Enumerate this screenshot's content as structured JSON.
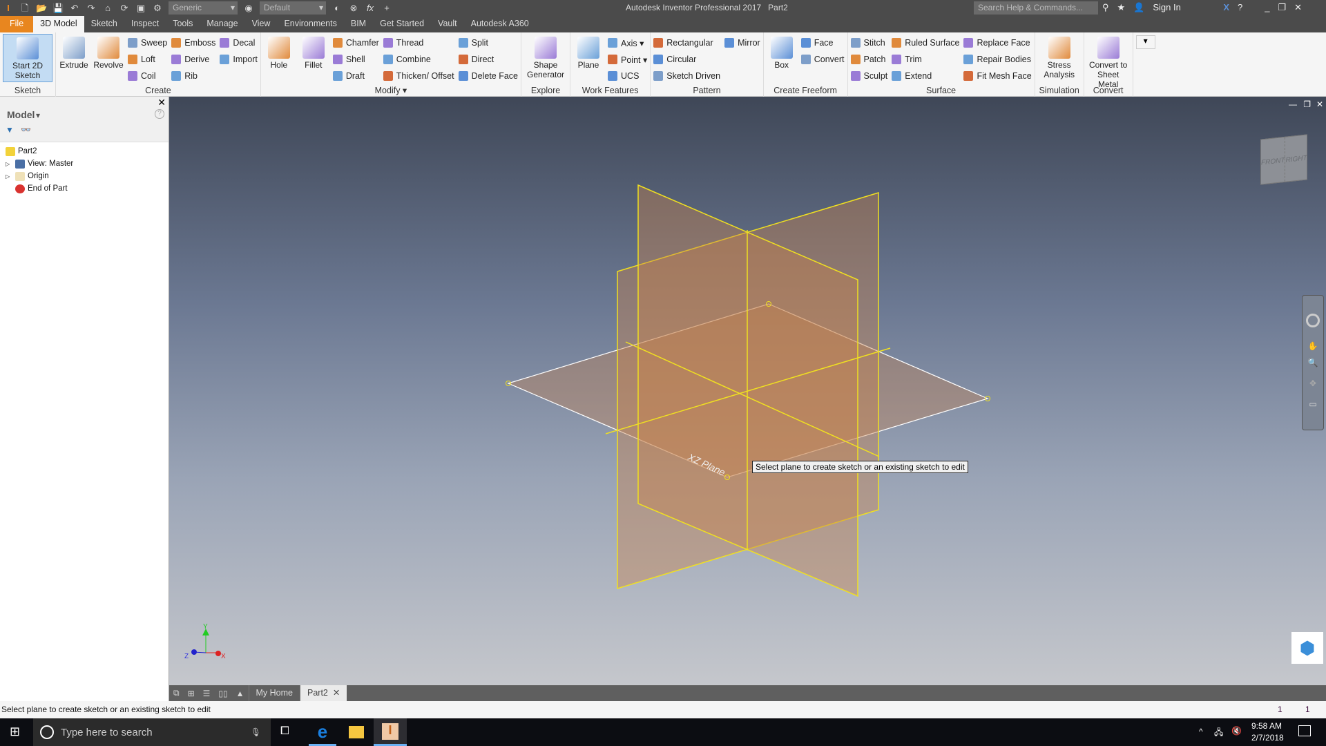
{
  "title_bar": {
    "app_title": "Autodesk Inventor Professional 2017",
    "doc_title": "Part2",
    "material_combo": "Generic",
    "appearance_combo": "Default",
    "search_placeholder": "Search Help & Commands...",
    "sign_in": "Sign In"
  },
  "tabs": [
    "File",
    "3D Model",
    "Sketch",
    "Inspect",
    "Tools",
    "Manage",
    "View",
    "Environments",
    "BIM",
    "Get Started",
    "Vault",
    "Autodesk A360"
  ],
  "active_tab": "3D Model",
  "ribbon": [
    {
      "title": "Sketch",
      "big": [
        "Start 2D Sketch"
      ],
      "cols": []
    },
    {
      "title": "Create",
      "big": [
        "Extrude",
        "Revolve"
      ],
      "cols": [
        [
          "Sweep",
          "Loft",
          "Coil"
        ],
        [
          "Emboss",
          "Derive",
          "Rib"
        ],
        [
          "Decal",
          "Import"
        ]
      ]
    },
    {
      "title": "Modify ▾",
      "big": [
        "Hole",
        "Fillet"
      ],
      "cols": [
        [
          "Chamfer",
          "Shell",
          "Draft"
        ],
        [
          "Thread",
          "Combine",
          "Thicken/ Offset"
        ],
        [
          "Split",
          "Direct",
          "Delete Face"
        ]
      ]
    },
    {
      "title": "Explore",
      "big": [
        "Shape Generator"
      ],
      "cols": []
    },
    {
      "title": "Work Features",
      "big": [
        "Plane"
      ],
      "cols": [
        [
          "Axis ▾",
          "Point ▾",
          "UCS"
        ]
      ]
    },
    {
      "title": "Pattern",
      "big": [],
      "cols": [
        [
          "Rectangular",
          "Circular",
          "Sketch Driven"
        ],
        [
          "Mirror"
        ]
      ]
    },
    {
      "title": "Create Freeform",
      "big": [
        "Box"
      ],
      "cols": [
        [
          "Face",
          "Convert"
        ]
      ]
    },
    {
      "title": "Surface",
      "big": [],
      "cols": [
        [
          "Stitch",
          "Patch",
          "Sculpt"
        ],
        [
          "Ruled Surface",
          "Trim",
          "Extend"
        ],
        [
          "Replace Face",
          "Repair Bodies",
          "Fit Mesh Face"
        ]
      ]
    },
    {
      "title": "Simulation",
      "big": [
        "Stress Analysis"
      ],
      "cols": []
    },
    {
      "title": "Convert",
      "big": [
        "Convert to Sheet Metal"
      ],
      "cols": []
    }
  ],
  "browser": {
    "title": "Model",
    "tree": [
      {
        "label": "Part2",
        "icon": "part-icon"
      },
      {
        "label": "View: Master",
        "icon": "view-icon"
      },
      {
        "label": "Origin",
        "icon": "folder-icon"
      },
      {
        "label": "End of Part",
        "icon": "end-of-part-icon"
      }
    ]
  },
  "viewport": {
    "plane_label": "XZ Plane",
    "tooltip": "Select plane to create sketch or an existing sketch to edit",
    "viewcube": {
      "front": "FRONT",
      "right": "RIGHT"
    },
    "axes": {
      "x": "X",
      "y": "Y",
      "z": "Z"
    }
  },
  "doc_tabs": [
    "My Home",
    "Part2"
  ],
  "status": {
    "message": "Select plane to create sketch or an existing sketch to edit",
    "count1": "1",
    "count2": "1"
  },
  "taskbar": {
    "search_placeholder": "Type here to search",
    "time": "9:58 AM",
    "date": "2/7/2018"
  },
  "colors": {
    "file_tab": "#e8861f",
    "plane_outline": "#f0e020",
    "plane_fill": "#c8824a"
  }
}
